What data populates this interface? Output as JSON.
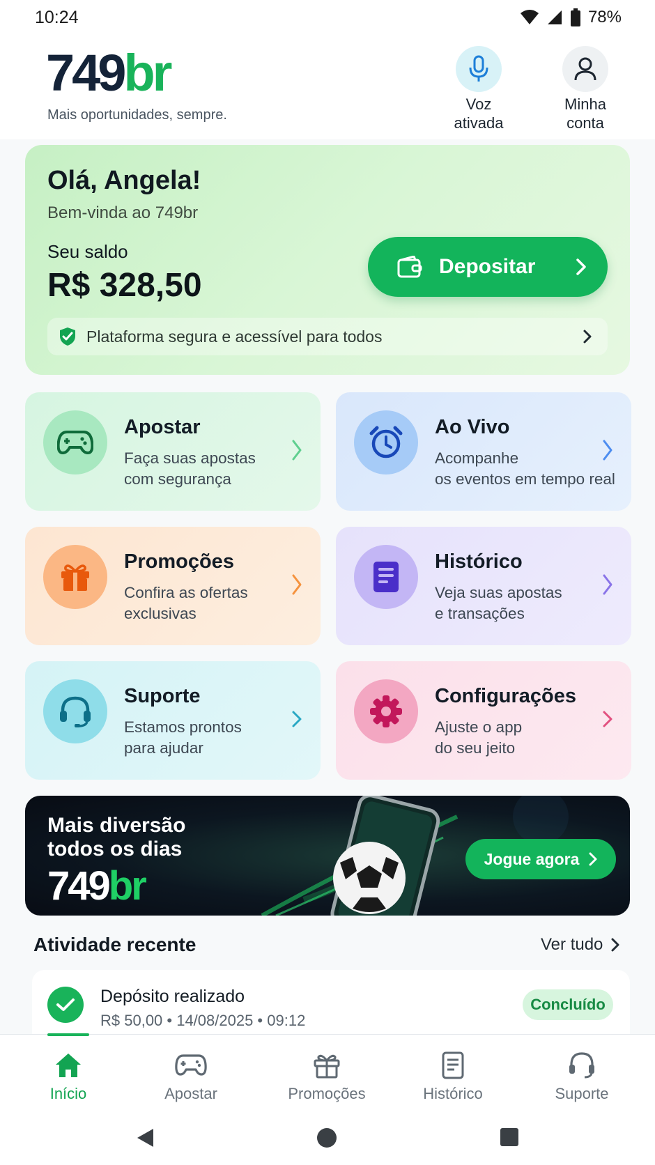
{
  "status_bar": {
    "time": "10:24",
    "battery": "78%"
  },
  "header": {
    "logo_num": "749",
    "logo_br": "br",
    "tagline": "Mais oportunidades, sempre.",
    "voice_label_1": "Voz",
    "voice_label_2": "ativada",
    "account_label_1": "Minha",
    "account_label_2": "conta"
  },
  "balance_card": {
    "greeting": "Olá, Angela!",
    "welcome": "Bem-vinda ao 749br",
    "balance_label": "Seu saldo",
    "balance_value": "R$ 328,50",
    "deposit_label": "Depositar",
    "secure_text": "Plataforma segura e acessível para todos"
  },
  "tiles": [
    {
      "title": "Apostar",
      "line1": "Faça suas apostas",
      "line2": "com segurança",
      "icon": "gamepad-icon",
      "accent": "#1e9e55"
    },
    {
      "title": "Ao Vivo",
      "line1": "Acompanhe",
      "line2": "os eventos em tempo real",
      "icon": "alarm-clock-icon",
      "accent": "#1f5fd6"
    },
    {
      "title": "Promoções",
      "line1": "Confira as ofertas",
      "line2": "exclusivas",
      "icon": "gift-icon",
      "accent": "#f07a1c"
    },
    {
      "title": "Histórico",
      "line1": "Veja suas apostas",
      "line2": "e transações",
      "icon": "document-icon",
      "accent": "#5b3fd6"
    },
    {
      "title": "Suporte",
      "line1": "Estamos prontos",
      "line2": "para ajudar",
      "icon": "headset-icon",
      "accent": "#1a8fb0"
    },
    {
      "title": "Configurações",
      "line1": "Ajuste o app",
      "line2": "do seu jeito",
      "icon": "gear-icon",
      "accent": "#d6336c"
    }
  ],
  "banner": {
    "line1": "Mais diversão",
    "line2": "todos os dias",
    "logo_num": "749",
    "logo_br": "br",
    "cta": "Jogue agora"
  },
  "activity": {
    "title": "Atividade recente",
    "see_all": "Ver tudo",
    "items": [
      {
        "title": "Depósito realizado",
        "detail": "R$ 50,00 • 14/08/2025 • 09:12",
        "status": "Concluído"
      }
    ]
  },
  "bottom_nav": [
    {
      "label": "Início",
      "icon": "home-icon",
      "active": true
    },
    {
      "label": "Apostar",
      "icon": "gamepad-icon",
      "active": false
    },
    {
      "label": "Promoções",
      "icon": "gift-icon",
      "active": false
    },
    {
      "label": "Histórico",
      "icon": "document-icon",
      "active": false
    },
    {
      "label": "Suporte",
      "icon": "headset-icon",
      "active": false
    }
  ],
  "colors": {
    "brand_green": "#19b35a",
    "brand_navy": "#142338"
  }
}
